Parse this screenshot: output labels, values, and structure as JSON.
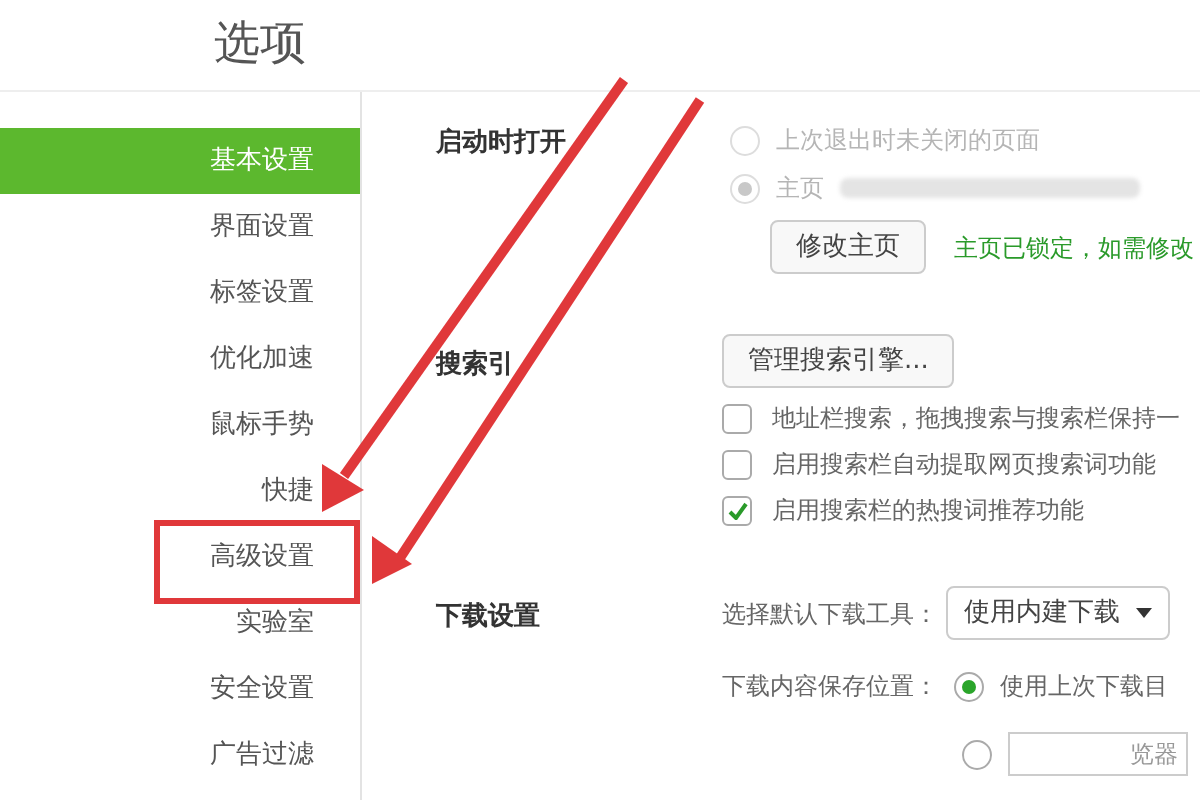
{
  "title": "选项",
  "sidebar": {
    "items": [
      {
        "label": "基本设置",
        "selected": true
      },
      {
        "label": "界面设置",
        "selected": false
      },
      {
        "label": "标签设置",
        "selected": false
      },
      {
        "label": "优化加速",
        "selected": false
      },
      {
        "label": "鼠标手势",
        "selected": false
      },
      {
        "label": "快捷",
        "selected": false
      },
      {
        "label": "高级设置",
        "selected": false,
        "highlighted": true
      },
      {
        "label": "实验室",
        "selected": false
      },
      {
        "label": "安全设置",
        "selected": false
      },
      {
        "label": "广告过滤",
        "selected": false
      }
    ]
  },
  "startup": {
    "label": "启动时打开",
    "options": [
      {
        "label": "上次退出时未关闭的页面",
        "selected": false,
        "disabled": true
      },
      {
        "label": "主页",
        "selected": true,
        "disabled": true
      }
    ],
    "button": "修改主页",
    "note": "主页已锁定，如需修改"
  },
  "search": {
    "label": "搜索引",
    "button": "管理搜索引擎...",
    "checkboxes": [
      {
        "label": "地址栏搜索，拖拽搜索与搜索栏保持一",
        "checked": false
      },
      {
        "label": "启用搜索栏自动提取网页搜索词功能",
        "checked": false
      },
      {
        "label": "启用搜索栏的热搜词推荐功能",
        "checked": true
      }
    ]
  },
  "download": {
    "label": "下载设置",
    "tool_label": "选择默认下载工具：",
    "tool_value": "使用内建下载",
    "location_label": "下载内容保存位置：",
    "locations": [
      {
        "label": "使用上次下载目",
        "selected": true
      },
      {
        "label": "览器",
        "selected": false
      }
    ]
  }
}
